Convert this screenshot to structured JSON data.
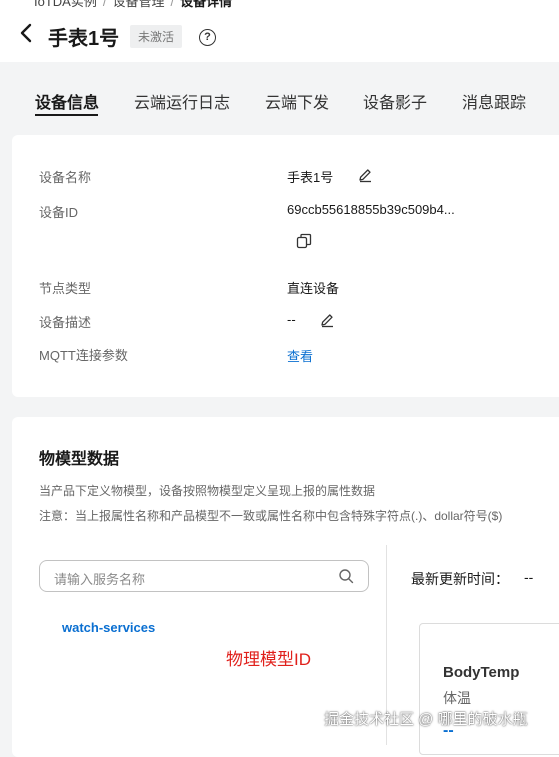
{
  "breadcrumb": {
    "root": "IoTDA实例",
    "mid": "设备管理",
    "current": "设备详情"
  },
  "header": {
    "title": "手表1号",
    "status": "未激活",
    "help": "?"
  },
  "tabs": [
    "设备信息",
    "云端运行日志",
    "云端下发",
    "设备影子",
    "消息跟踪"
  ],
  "device_info": {
    "name_label": "设备名称",
    "name_value": "手表1号",
    "id_label": "设备ID",
    "id_value": "69ccb55618855b39c509b4...",
    "node_label": "节点类型",
    "node_value": "直连设备",
    "desc_label": "设备描述",
    "desc_value": "--",
    "mqtt_label": "MQTT连接参数",
    "mqtt_link": "查看"
  },
  "model": {
    "title": "物模型数据",
    "desc1": "当产品下定义物模型，设备按照物模型定义呈现上报的属性数据",
    "desc2": "注意：当上报属性名称和产品模型不一致或属性名称中包含特殊字符点(.)、dollar符号($)",
    "search_placeholder": "请输入服务名称",
    "service": "watch-services",
    "annotation": "物理模型ID",
    "updated_label": "最新更新时间：",
    "updated_value": "--",
    "property": {
      "name": "BodyTemp",
      "cn": "体温",
      "value": "--"
    }
  },
  "watermark": "掘金技术社区 @ 哪里的破水瓶",
  "colors": {
    "link": "#0a6fd1",
    "annotation": "#e0201b",
    "background": "#f3f4f5"
  }
}
